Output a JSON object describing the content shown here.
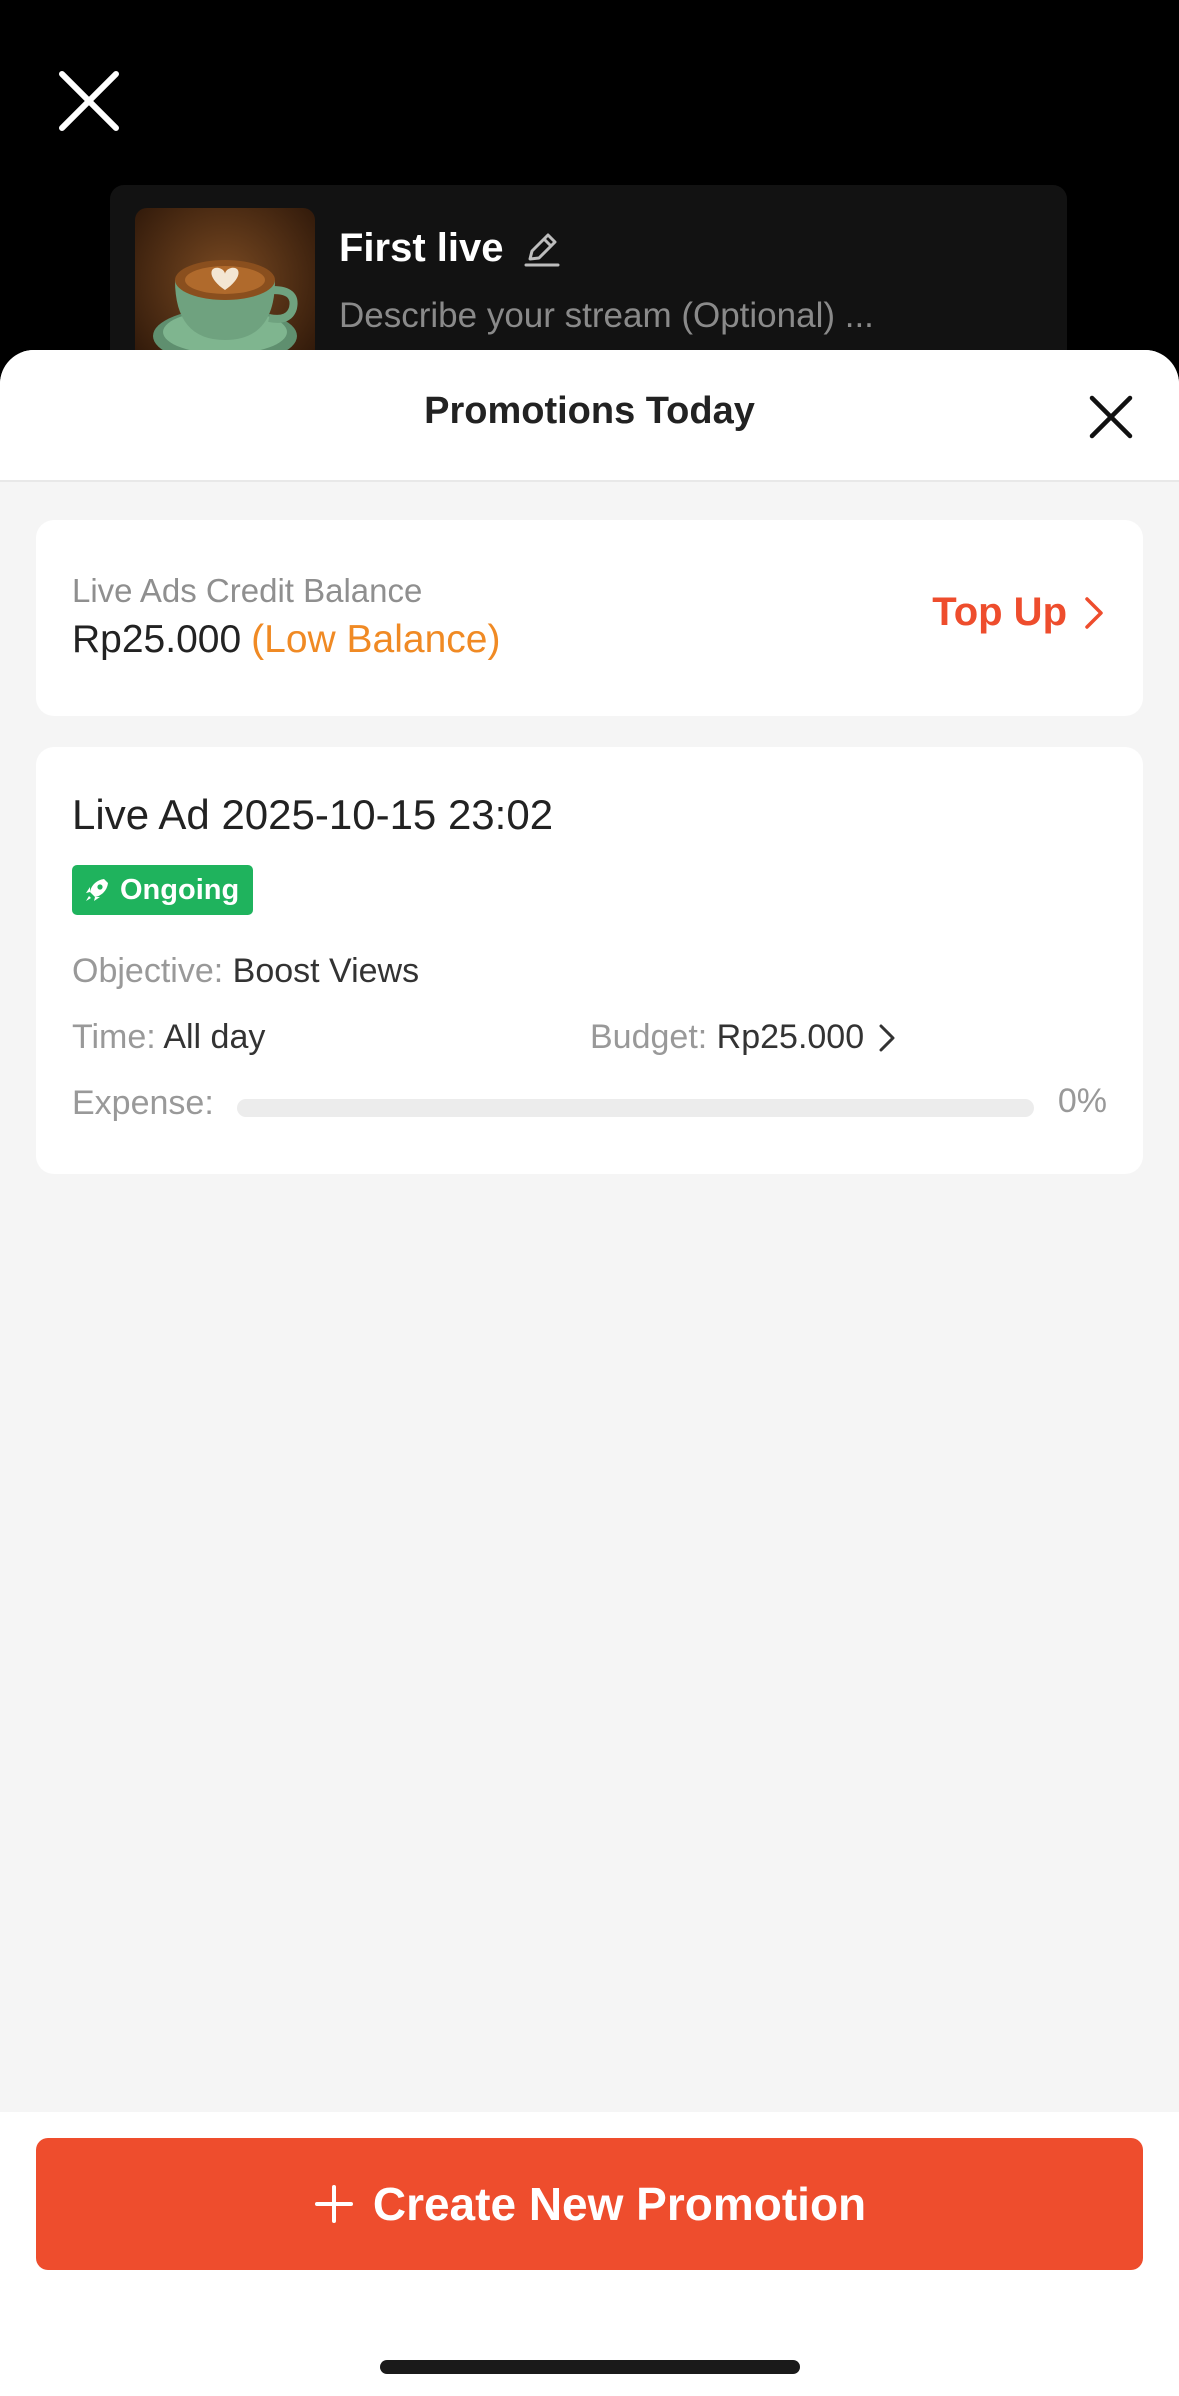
{
  "stream": {
    "title": "First live",
    "description": "Describe your stream (Optional) ...",
    "thumbnail": "latte-art-coffee-cup"
  },
  "sheet": {
    "title": "Promotions Today"
  },
  "balance": {
    "label": "Live Ads Credit Balance",
    "amount": "Rp25.000",
    "status": "(Low Balance)",
    "top_up_label": "Top Up"
  },
  "ad": {
    "title": "Live Ad 2025-10-15 23:02",
    "status": "Ongoing",
    "objective_label": "Objective:",
    "objective": "Boost Views",
    "time_label": "Time:",
    "time": "All day",
    "budget_label": "Budget:",
    "budget": "Rp25.000",
    "expense_label": "Expense:",
    "expense_percent": "0%",
    "expense_fraction": 0
  },
  "footer": {
    "create_label": "Create New Promotion"
  },
  "colors": {
    "brand": "#ee4d2d",
    "warning": "#f08a24",
    "success": "#1fb35d"
  }
}
